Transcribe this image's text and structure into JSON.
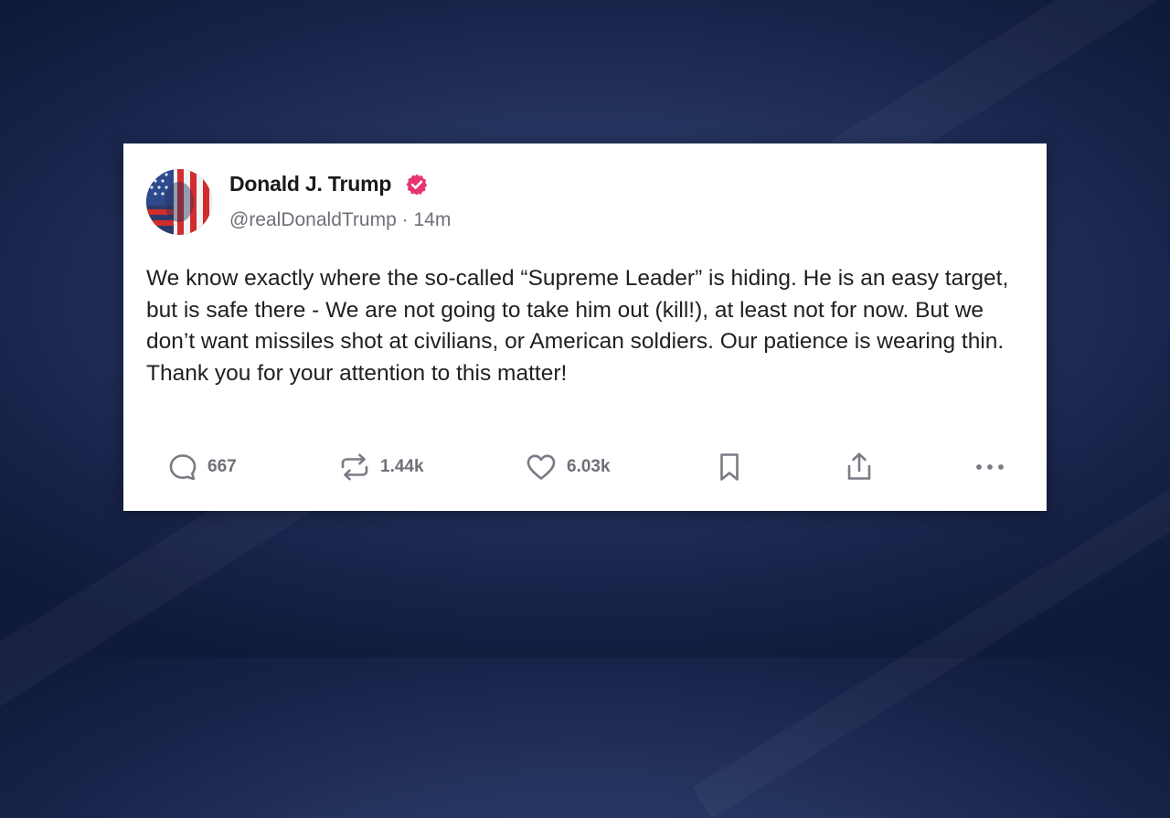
{
  "post": {
    "author": {
      "display_name": "Donald J. Trump",
      "handle": "@realDonaldTrump",
      "verified": true,
      "avatar_icon": "avatar-flag-portrait"
    },
    "separator": "·",
    "time_ago": "14m",
    "text": "We know exactly where the so-called “Supreme Leader” is hiding. He is an easy target, but is safe there - We are not going to take him out (kill!), at least not for now. But we don’t want missiles shot at civilians, or American soldiers. Our patience is wearing thin. Thank you for your attention to this matter!",
    "actions": {
      "replies": "667",
      "reposts": "1.44k",
      "likes": "6.03k"
    }
  },
  "colors": {
    "verified_badge": "#e8356d",
    "text": "#1f1f24",
    "muted": "#6f6f78",
    "background": "#263560",
    "card": "#ffffff"
  },
  "icons": [
    "reply-icon",
    "repost-icon",
    "like-icon",
    "bookmark-icon",
    "share-icon",
    "more-icon",
    "verified-badge-icon"
  ]
}
